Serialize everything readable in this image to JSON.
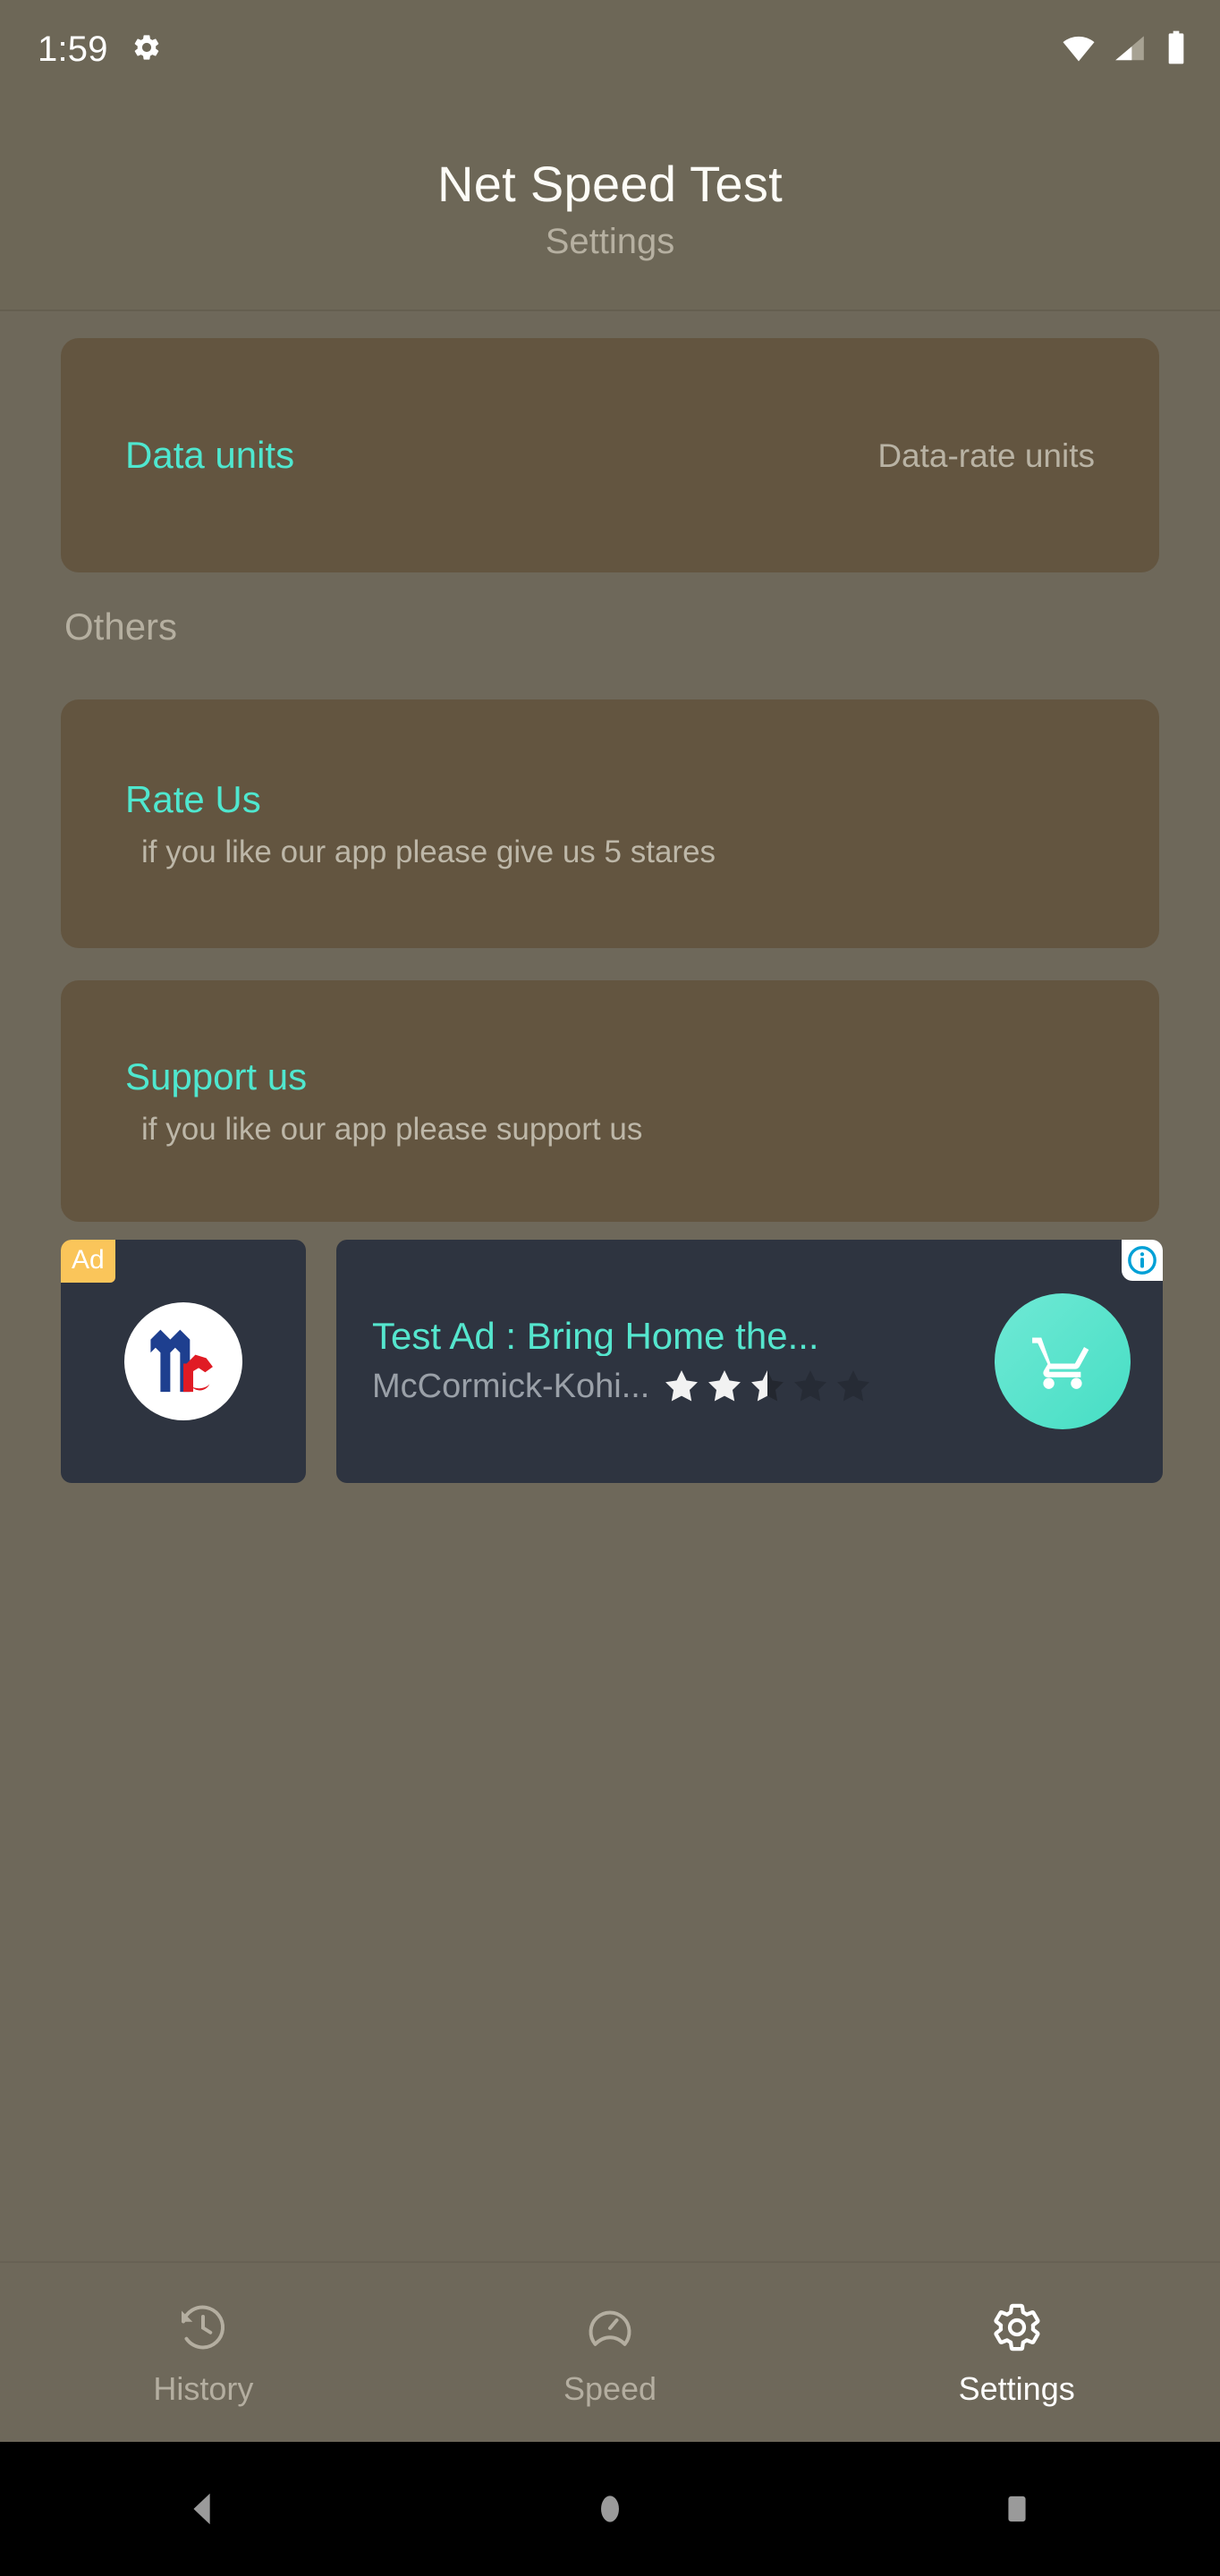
{
  "status_bar": {
    "clock": "1:59",
    "icons": [
      "gear-icon",
      "wifi-icon",
      "cellular-signal-icon",
      "battery-icon"
    ]
  },
  "header": {
    "title": "Net Speed Test",
    "subtitle": "Settings"
  },
  "settings": {
    "data_units": {
      "label": "Data units",
      "value": "Data-rate units"
    },
    "section_others": "Others",
    "rate_us": {
      "label": "Rate Us",
      "description": "if you like our app please give us 5 stares"
    },
    "support_us": {
      "label": "Support us",
      "description": "if you like our app please support us"
    }
  },
  "ad": {
    "badge": "Ad",
    "headline": "Test Ad : Bring Home the...",
    "advertiser": "McCormick-Kohi...",
    "rating": 2.5,
    "rating_max": 5,
    "cta_icon": "shopping-cart-icon",
    "info_icon": "info-icon",
    "logo_icon": "mccormick-logo-icon"
  },
  "bottom_nav": {
    "items": [
      {
        "label": "History",
        "icon": "history-icon",
        "active": false
      },
      {
        "label": "Speed",
        "icon": "speedometer-icon",
        "active": false
      },
      {
        "label": "Settings",
        "icon": "gear-icon",
        "active": true
      }
    ]
  },
  "system_nav": {
    "back": "back-triangle-icon",
    "home": "home-circle-icon",
    "recents": "recents-square-icon"
  },
  "colors": {
    "background": "#6e685a",
    "header": "#6d6757",
    "card": "#635540",
    "accent_teal": "#4fe7cf",
    "muted_text": "#b5afa0",
    "ad_surface": "#2e3440",
    "ad_badge": "#fac55a"
  }
}
